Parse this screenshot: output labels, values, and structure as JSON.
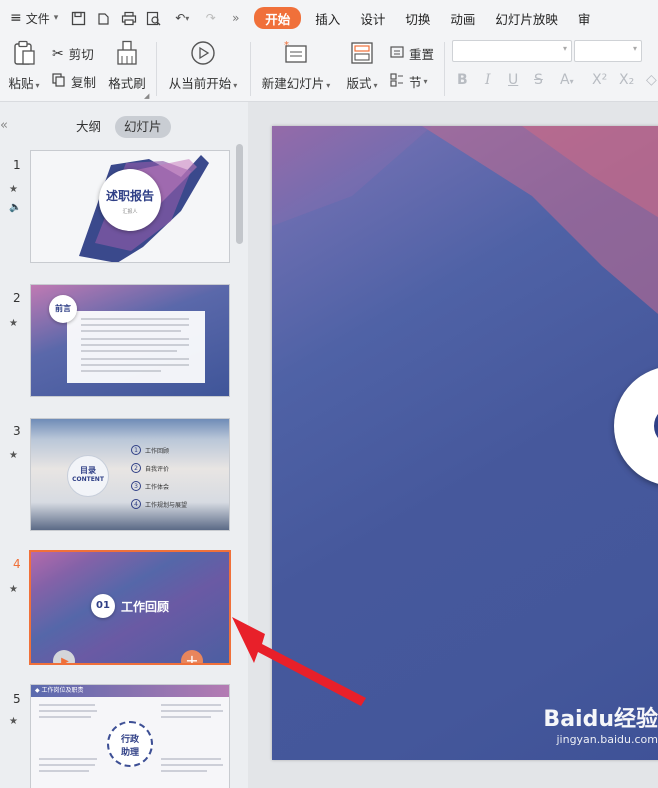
{
  "menu": {
    "file_label": "文件",
    "tabs": [
      "开始",
      "插入",
      "设计",
      "切换",
      "动画",
      "幻灯片放映",
      "审"
    ]
  },
  "ribbon": {
    "paste": "粘贴",
    "cut": "剪切",
    "copy": "复制",
    "format_painter": "格式刷",
    "from_current": "从当前开始",
    "new_slide": "新建幻灯片",
    "layout": "版式",
    "reset": "重置",
    "section": "节"
  },
  "panel": {
    "outline_tab": "大纲",
    "slides_tab": "幻灯片"
  },
  "slides": [
    {
      "number": "1",
      "title": "述职报告",
      "subtitle": "汇报人"
    },
    {
      "number": "2",
      "heading": "前言"
    },
    {
      "number": "3",
      "toc_title": "目录",
      "toc_sub": "CONTENT",
      "items": [
        "工作回顾",
        "自我评价",
        "工作体会",
        "工作规划与展望"
      ],
      "item_nums": [
        "1",
        "2",
        "3",
        "4"
      ]
    },
    {
      "number": "4",
      "section_no": "01",
      "section_title": "工作回顾",
      "current": true
    },
    {
      "number": "5",
      "header": "工作岗位及职责",
      "circle_top": "行政",
      "circle_bottom": "助理"
    }
  ],
  "watermark": {
    "brand": "Baidu经验",
    "url": "jingyan.baidu.com"
  },
  "colors": {
    "accent": "#f0703a",
    "arrow": "#e8202a"
  }
}
